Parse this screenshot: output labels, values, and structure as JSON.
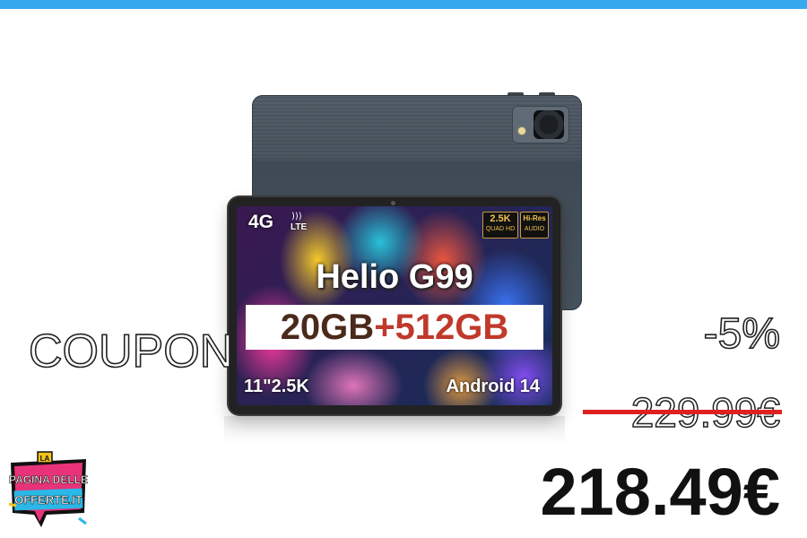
{
  "tablet": {
    "screen": {
      "network": "4G",
      "network_sub": "LTE",
      "badge_resolution_top": "2.5K",
      "badge_resolution_bottom": "QUAD HD",
      "badge_audio_top": "Hi-Res",
      "badge_audio_bottom": "AUDIO",
      "chip": "Helio G99",
      "memory_ram": "20GB",
      "memory_plus": "+",
      "memory_storage": "512GB",
      "display": "11\"2.5K",
      "os": "Android 14"
    }
  },
  "offer": {
    "coupon_label": "COUPON",
    "discount": "-5%",
    "old_price": "229.99€",
    "new_price": "218.49€"
  },
  "logo": {
    "line1": "LA",
    "line2": "PAGINA DELLE",
    "line3": "OFFERTE.IT"
  },
  "colors": {
    "top_bar": "#36a9ee",
    "strike": "#e01f1f",
    "new_price": "#111111",
    "logo_pink": "#e8337a",
    "logo_cyan": "#2bb7e8",
    "logo_yellow": "#f3c21d"
  }
}
